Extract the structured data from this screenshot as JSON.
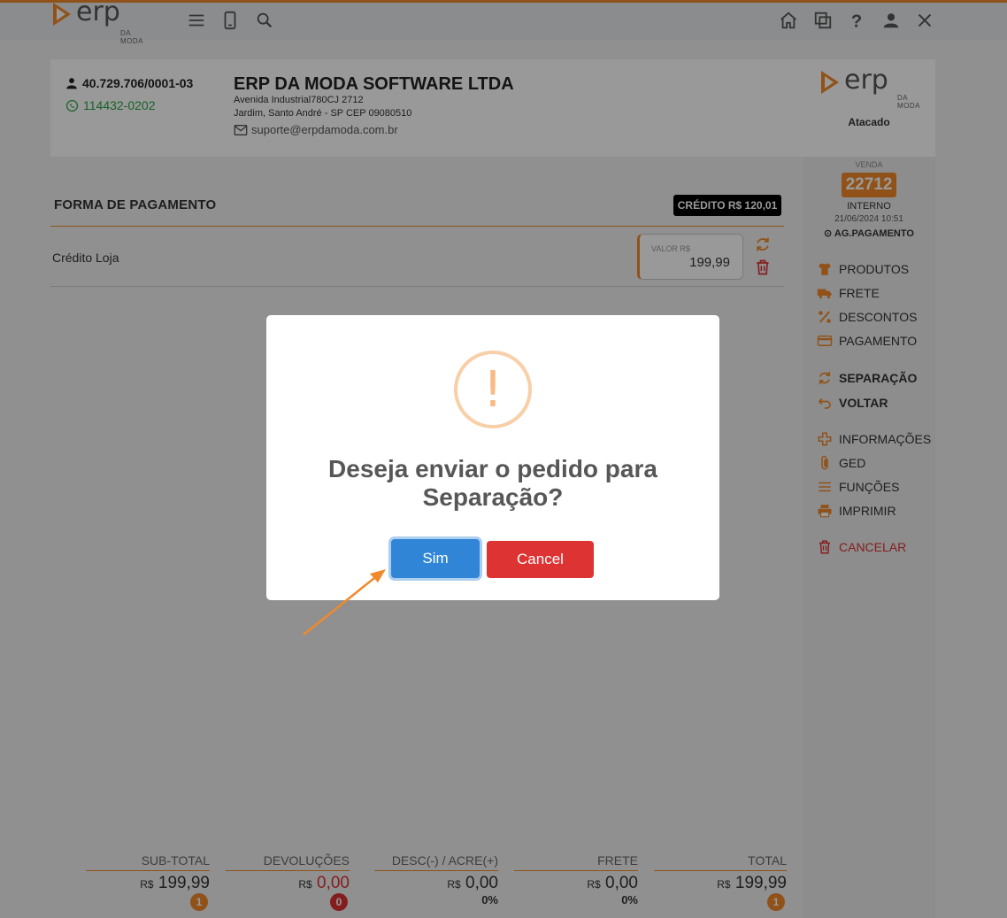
{
  "brand": {
    "logo_text": "erp",
    "logo_sub": "DA MODA",
    "accent": "#f0892b"
  },
  "topbar": {
    "icons": [
      "menu-icon",
      "mobile-icon",
      "search-icon",
      "home-icon",
      "copy-icon",
      "help-icon",
      "user-icon",
      "close-icon"
    ]
  },
  "company": {
    "cnpj": "40.729.706/0001-03",
    "phone": "114432-0202",
    "name": "ERP DA MODA SOFTWARE LTDA",
    "address_line1": "Avenida Industrial780CJ 2712",
    "address_line2": "Jardim, Santo André - SP CEP 09080510",
    "email": "suporte@erpdamoda.com.br",
    "segment": "Atacado"
  },
  "sale": {
    "label": "VENDA",
    "number": "22712",
    "type": "INTERNO",
    "datetime": "21/06/2024 10:51",
    "status": "AG.PAGAMENTO"
  },
  "menu": {
    "produtos": "PRODUTOS",
    "frete": "FRETE",
    "descontos": "DESCONTOS",
    "pagamento": "PAGAMENTO",
    "separacao": "SEPARAÇÃO",
    "voltar": "VOLTAR",
    "informacoes": "INFORMAÇÕES",
    "ged": "GED",
    "funcoes": "FUNÇÕES",
    "imprimir": "IMPRIMIR",
    "cancelar": "CANCELAR"
  },
  "payment": {
    "title": "FORMA DE PAGAMENTO",
    "credit_badge": "CRÉDITO R$ 120,01",
    "method": "Crédito Loja",
    "value_label": "VALOR R$",
    "value": "199,99"
  },
  "totals": {
    "subtotal": {
      "label": "SUB-TOTAL",
      "currency": "R$",
      "value": "199,99",
      "badge": "1"
    },
    "devolucoes": {
      "label": "DEVOLUÇÕES",
      "currency": "R$",
      "value": "0,00",
      "badge": "0"
    },
    "desc_acre": {
      "label": "DESC(-) / ACRE(+)",
      "currency": "R$",
      "value": "0,00",
      "percent": "0%"
    },
    "frete": {
      "label": "FRETE",
      "currency": "R$",
      "value": "0,00",
      "percent": "0%"
    },
    "total": {
      "label": "TOTAL",
      "currency": "R$",
      "value": "199,99",
      "badge": "1"
    }
  },
  "dialog": {
    "icon": "!",
    "title": "Deseja enviar o pedido para Separação?",
    "confirm": "Sim",
    "cancel": "Cancel"
  }
}
